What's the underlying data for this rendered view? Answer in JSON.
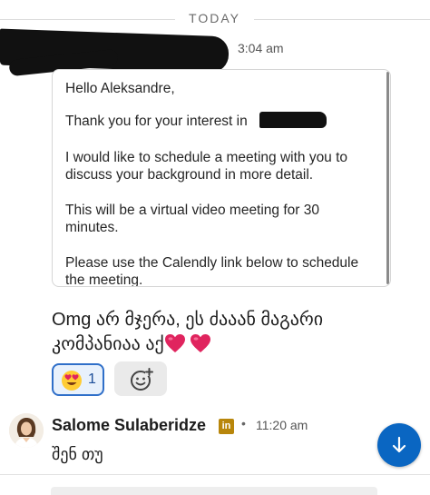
{
  "date_divider": "TODAY",
  "message_1": {
    "time": "3:04 am",
    "card_lines": [
      "Hello Aleksandre,",
      "Thank you for your interest in",
      "I would like to schedule a meeting with you to",
      "discuss your background in more detail.",
      "This will be a virtual video meeting for 30",
      "minutes.",
      "Please use the Calendly link below to schedule",
      "the meeting."
    ]
  },
  "reply": {
    "line1": "Omg არ მჯერა, ეს ძააან მაგარი",
    "line2": "კომპანიაა აქ"
  },
  "reactions": [
    {
      "emoji": "heart-eyes",
      "count": "1",
      "selected": true
    }
  ],
  "message_2": {
    "sender": "Salome Sulaberidze",
    "badge": "in",
    "separator": "•",
    "time": "11:20 am",
    "text": "შენ თუ"
  },
  "colors": {
    "accent": "#0a66c2",
    "reaction_border": "#2f6fc9",
    "reaction_bg": "#e8f1fc",
    "badge": "#b8860b",
    "heart": "#e0245e"
  }
}
